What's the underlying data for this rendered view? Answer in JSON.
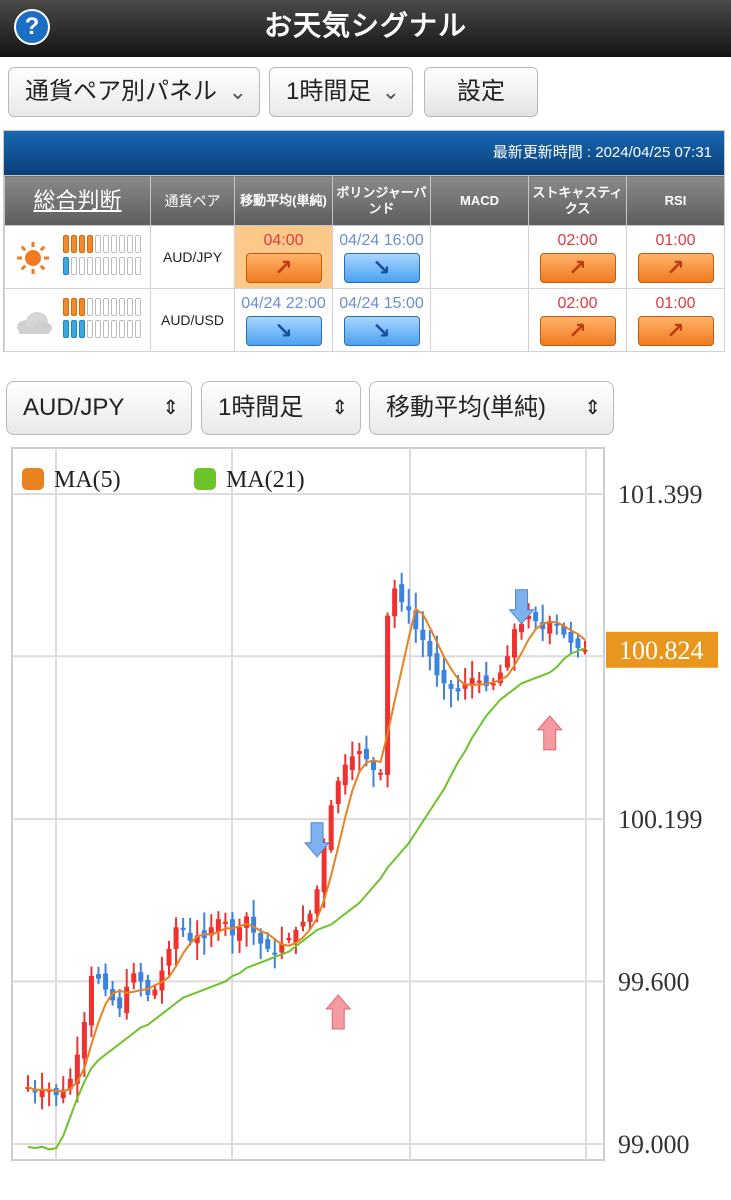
{
  "header": {
    "title": "お天気シグナル",
    "help_label": "?"
  },
  "controls": {
    "panel_select": "通貨ペア別パネル",
    "timeframe_select": "1時間足",
    "settings_button": "設定"
  },
  "signal_table": {
    "updated": "最新更新時間 : 2024/04/25 07:31",
    "headers": [
      "総合判断",
      "通貨ペア",
      "移動平均(単純)",
      "ボリンジャーバンド",
      "MACD",
      "ストキャスティクス",
      "RSI"
    ],
    "rows": [
      {
        "weather": "sun-icon",
        "meter": {
          "orange": 4,
          "blue": 1,
          "total": 10
        },
        "pair": "AUD/JPY",
        "signals": [
          {
            "time": "04:00",
            "dir": "up",
            "highlight": true
          },
          {
            "time": "04/24 16:00",
            "dir": "down",
            "highlight": false
          },
          {
            "time": "",
            "dir": "",
            "highlight": false
          },
          {
            "time": "02:00",
            "dir": "up",
            "highlight": false
          },
          {
            "time": "01:00",
            "dir": "up",
            "highlight": false
          }
        ]
      },
      {
        "weather": "cloud-icon",
        "meter": {
          "orange": 3,
          "blue": 3,
          "total": 10
        },
        "pair": "AUD/USD",
        "signals": [
          {
            "time": "04/24 22:00",
            "dir": "down",
            "highlight": false
          },
          {
            "time": "04/24 15:00",
            "dir": "down",
            "highlight": false
          },
          {
            "time": "",
            "dir": "",
            "highlight": false
          },
          {
            "time": "02:00",
            "dir": "up",
            "highlight": false
          },
          {
            "time": "01:00",
            "dir": "up",
            "highlight": false
          }
        ]
      }
    ]
  },
  "chart_controls": {
    "pair_select": "AUD/JPY",
    "timeframe_select": "1時間足",
    "indicator_select": "移動平均(単純)"
  },
  "chart_data": {
    "type": "candlestick",
    "legend": [
      {
        "name": "MA(5)",
        "color": "#e8821e"
      },
      {
        "name": "MA(21)",
        "color": "#6cc42a"
      }
    ],
    "y_ticks": [
      "101.399",
      "100.199",
      "99.600",
      "99.000"
    ],
    "ylim": [
      98.95,
      101.52
    ],
    "current_price": "100.824",
    "current_value": 100.824,
    "colors": {
      "up": "#f0312f",
      "down": "#3c83e0",
      "current_label": "#e8961e"
    },
    "ma21": [
      98.99,
      98.985,
      98.99,
      98.98,
      98.985,
      99.03,
      99.1,
      99.17,
      99.23,
      99.28,
      99.31,
      99.33,
      99.35,
      99.37,
      99.39,
      99.41,
      99.43,
      99.44,
      99.46,
      99.48,
      99.5,
      99.52,
      99.54,
      99.55,
      99.56,
      99.57,
      99.58,
      99.59,
      99.6,
      99.62,
      99.63,
      99.65,
      99.66,
      99.67,
      99.68,
      99.69,
      99.7,
      99.71,
      99.73,
      99.75,
      99.77,
      99.79,
      99.8,
      99.81,
      99.83,
      99.85,
      99.87,
      99.89,
      99.92,
      99.95,
      99.98,
      100.02,
      100.05,
      100.08,
      100.11,
      100.15,
      100.19,
      100.23,
      100.27,
      100.31,
      100.36,
      100.41,
      100.45,
      100.5,
      100.54,
      100.58,
      100.61,
      100.64,
      100.66,
      100.68,
      100.7,
      100.71,
      100.72,
      100.73,
      100.74,
      100.76,
      100.79,
      100.81,
      100.82,
      100.83
    ],
    "arrows": [
      {
        "index": 41,
        "dir": "down",
        "value": 100.06
      },
      {
        "index": 44,
        "dir": "up",
        "value": 99.55
      },
      {
        "index": 70,
        "dir": "down",
        "value": 100.92
      },
      {
        "index": 74,
        "dir": "up",
        "value": 100.58
      }
    ]
  }
}
